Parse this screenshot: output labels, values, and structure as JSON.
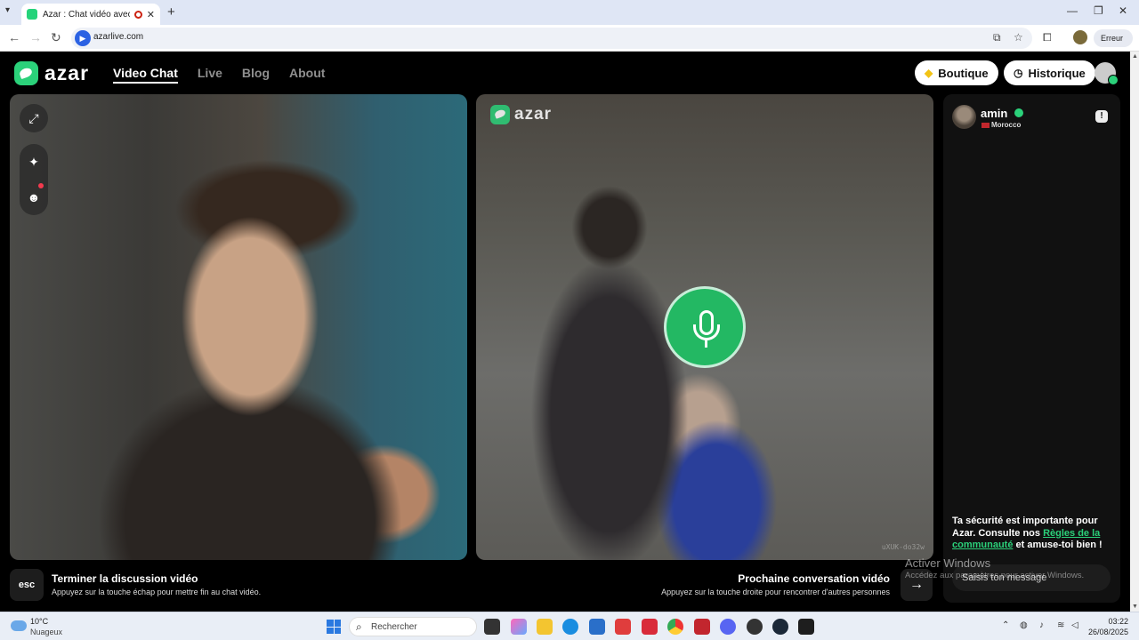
{
  "browser": {
    "tab_title": "Azar : Chat vidéo avec de n",
    "tab_close": "✕",
    "new_tab": "+",
    "url": "azarlive.com",
    "error_label": "Erreur",
    "window_controls": [
      "—",
      "❐",
      "✕"
    ]
  },
  "site": {
    "logo_text": "azar",
    "nav": [
      {
        "label": "Video Chat",
        "active": true
      },
      {
        "label": "Live",
        "active": false
      },
      {
        "label": "Blog",
        "active": false
      },
      {
        "label": "About",
        "active": false
      }
    ],
    "shop_label": "Boutique",
    "history_label": "Historique"
  },
  "video": {
    "remote_logo": "azar",
    "remote_id": "uXUK-do32w"
  },
  "chat": {
    "user_name": "amin",
    "country": "Morocco",
    "safety_prefix": "Ta sécurité est importante pour Azar. Consulte nos ",
    "safety_link": "Règles de la communauté",
    "safety_suffix": " et amuse-toi bien !",
    "input_placeholder": "Saisis ton message"
  },
  "controls": {
    "esc_key": "esc",
    "end_title": "Terminer la discussion vidéo",
    "end_subtitle": "Appuyez sur la touche échap pour mettre fin au chat vidéo.",
    "next_title": "Prochaine conversation vidéo",
    "next_subtitle": "Appuyez sur la touche droite pour rencontrer d'autres personnes",
    "next_arrow": "→"
  },
  "watermark": {
    "title": "Activer Windows",
    "subtitle": "Accédez aux paramètres pour activer Windows."
  },
  "taskbar": {
    "temperature": "10°C",
    "condition": "Nuageux",
    "search_placeholder": "Rechercher",
    "time": "03:22",
    "date": "26/08/2025"
  },
  "colors": {
    "brand_green": "#2bd17a",
    "mic_green": "#23b863",
    "background": "#000000"
  }
}
